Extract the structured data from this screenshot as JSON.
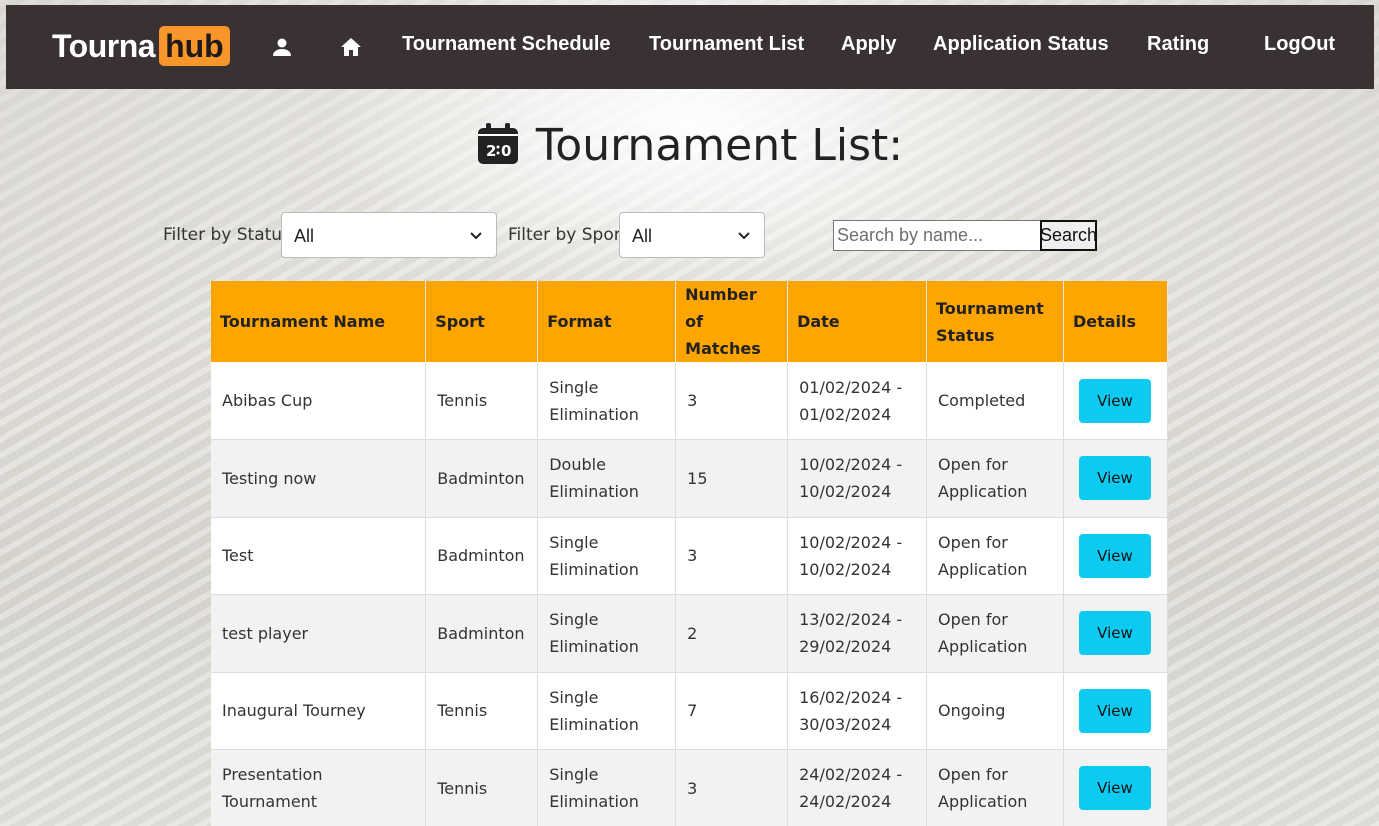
{
  "app": {
    "logo_left": "Tourna",
    "logo_right": "hub"
  },
  "nav": {
    "links": [
      {
        "label": "Tournament Schedule"
      },
      {
        "label": "Tournament List"
      },
      {
        "label": "Apply"
      },
      {
        "label": "Application Status"
      },
      {
        "label": "Rating"
      },
      {
        "label": "LogOut"
      }
    ],
    "icons": [
      "user-icon",
      "home-icon"
    ]
  },
  "page": {
    "title": "Tournament List:",
    "title_icon": "calendar-scoreboard-icon"
  },
  "filters": {
    "status_label": "Filter by Status",
    "status_value": "All",
    "sport_label": "Filter by Sport",
    "sport_value": "All",
    "search_placeholder": "Search by name...",
    "search_button": "Search"
  },
  "table": {
    "headers": [
      "Tournament Name",
      "Sport",
      "Format",
      "Number of Matches",
      "Date",
      "Tournament Status",
      "Details"
    ],
    "rows": [
      {
        "name": "Abibas Cup",
        "sport": "Tennis",
        "format": "Single Elimination",
        "matches": "3",
        "date": "01/02/2024 - 01/02/2024",
        "status": "Completed",
        "action": "View"
      },
      {
        "name": "Testing now",
        "sport": "Badminton",
        "format": "Double Elimination",
        "matches": "15",
        "date": "10/02/2024 - 10/02/2024",
        "status": "Open for Application",
        "action": "View"
      },
      {
        "name": "Test",
        "sport": "Badminton",
        "format": "Single Elimination",
        "matches": "3",
        "date": "10/02/2024 - 10/02/2024",
        "status": "Open for Application",
        "action": "View"
      },
      {
        "name": "test player",
        "sport": "Badminton",
        "format": "Single Elimination",
        "matches": "2",
        "date": "13/02/2024 - 29/02/2024",
        "status": "Open for Application",
        "action": "View"
      },
      {
        "name": "Inaugural Tourney",
        "sport": "Tennis",
        "format": "Single Elimination",
        "matches": "7",
        "date": "16/02/2024 - 30/03/2024",
        "status": "Ongoing",
        "action": "View"
      },
      {
        "name": "Presentation Tournament",
        "sport": "Tennis",
        "format": "Single Elimination",
        "matches": "3",
        "date": "24/02/2024 - 24/02/2024",
        "status": "Open for Application",
        "action": "View"
      }
    ]
  },
  "colors": {
    "navbar": "#3a3232",
    "logo_accent": "#f7962a",
    "table_header": "#ffa500",
    "view_button": "#0dcaf0"
  }
}
